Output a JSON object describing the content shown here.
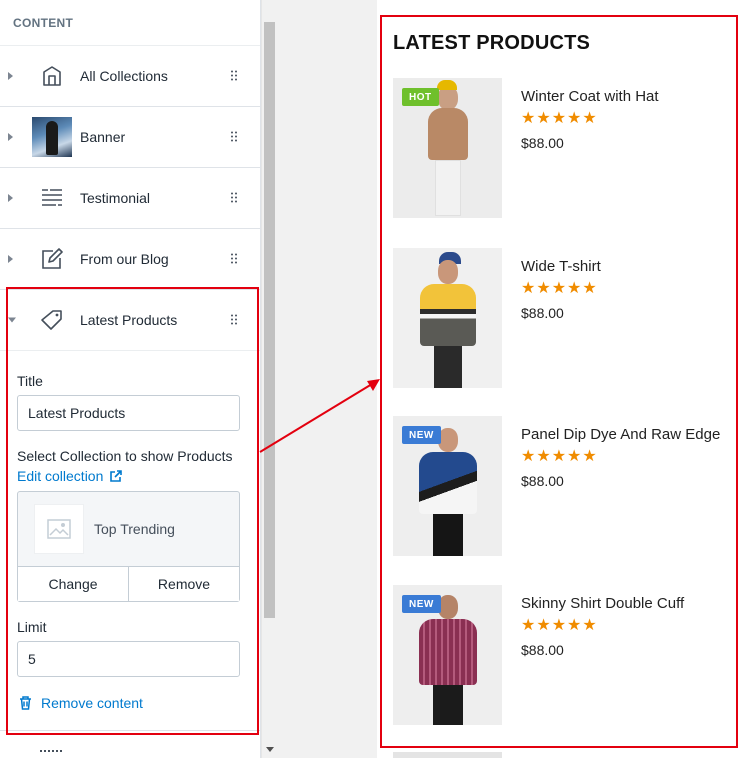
{
  "sidebar": {
    "section_title": "CONTENT",
    "items": [
      {
        "label": "All Collections",
        "icon": "collections-icon"
      },
      {
        "label": "Banner",
        "icon": "banner-thumbnail"
      },
      {
        "label": "Testimonial",
        "icon": "text-list-icon"
      },
      {
        "label": "From our Blog",
        "icon": "edit-icon"
      },
      {
        "label": "Latest Products",
        "icon": "tag-icon"
      }
    ],
    "latest_products": {
      "title_label": "Title",
      "title_value": "Latest Products",
      "collection_label": "Select Collection to show Products",
      "edit_collection_link": "Edit collection",
      "collection_name": "Top Trending",
      "change_button": "Change",
      "remove_button": "Remove",
      "limit_label": "Limit",
      "limit_value": "5",
      "remove_content_link": "Remove content"
    }
  },
  "preview": {
    "title": "LATEST PRODUCTS",
    "products": [
      {
        "name": "Winter Coat with Hat",
        "rating": "★★★★★",
        "price": "$88.00",
        "badge": "HOT",
        "badge_color": "#6fc02c"
      },
      {
        "name": "Wide T-shirt",
        "rating": "★★★★★",
        "price": "$88.00",
        "badge": "",
        "badge_color": ""
      },
      {
        "name": "Panel Dip Dye And Raw Edge",
        "rating": "★★★★★",
        "price": "$88.00",
        "badge": "NEW",
        "badge_color": "#3a7bd5"
      },
      {
        "name": "Skinny Shirt Double Cuff",
        "rating": "★★★★★",
        "price": "$88.00",
        "badge": "NEW",
        "badge_color": "#3a7bd5"
      }
    ]
  },
  "colors": {
    "annotation_red": "#e3000f",
    "link_blue": "#007ace",
    "star_orange": "#f08c00"
  }
}
